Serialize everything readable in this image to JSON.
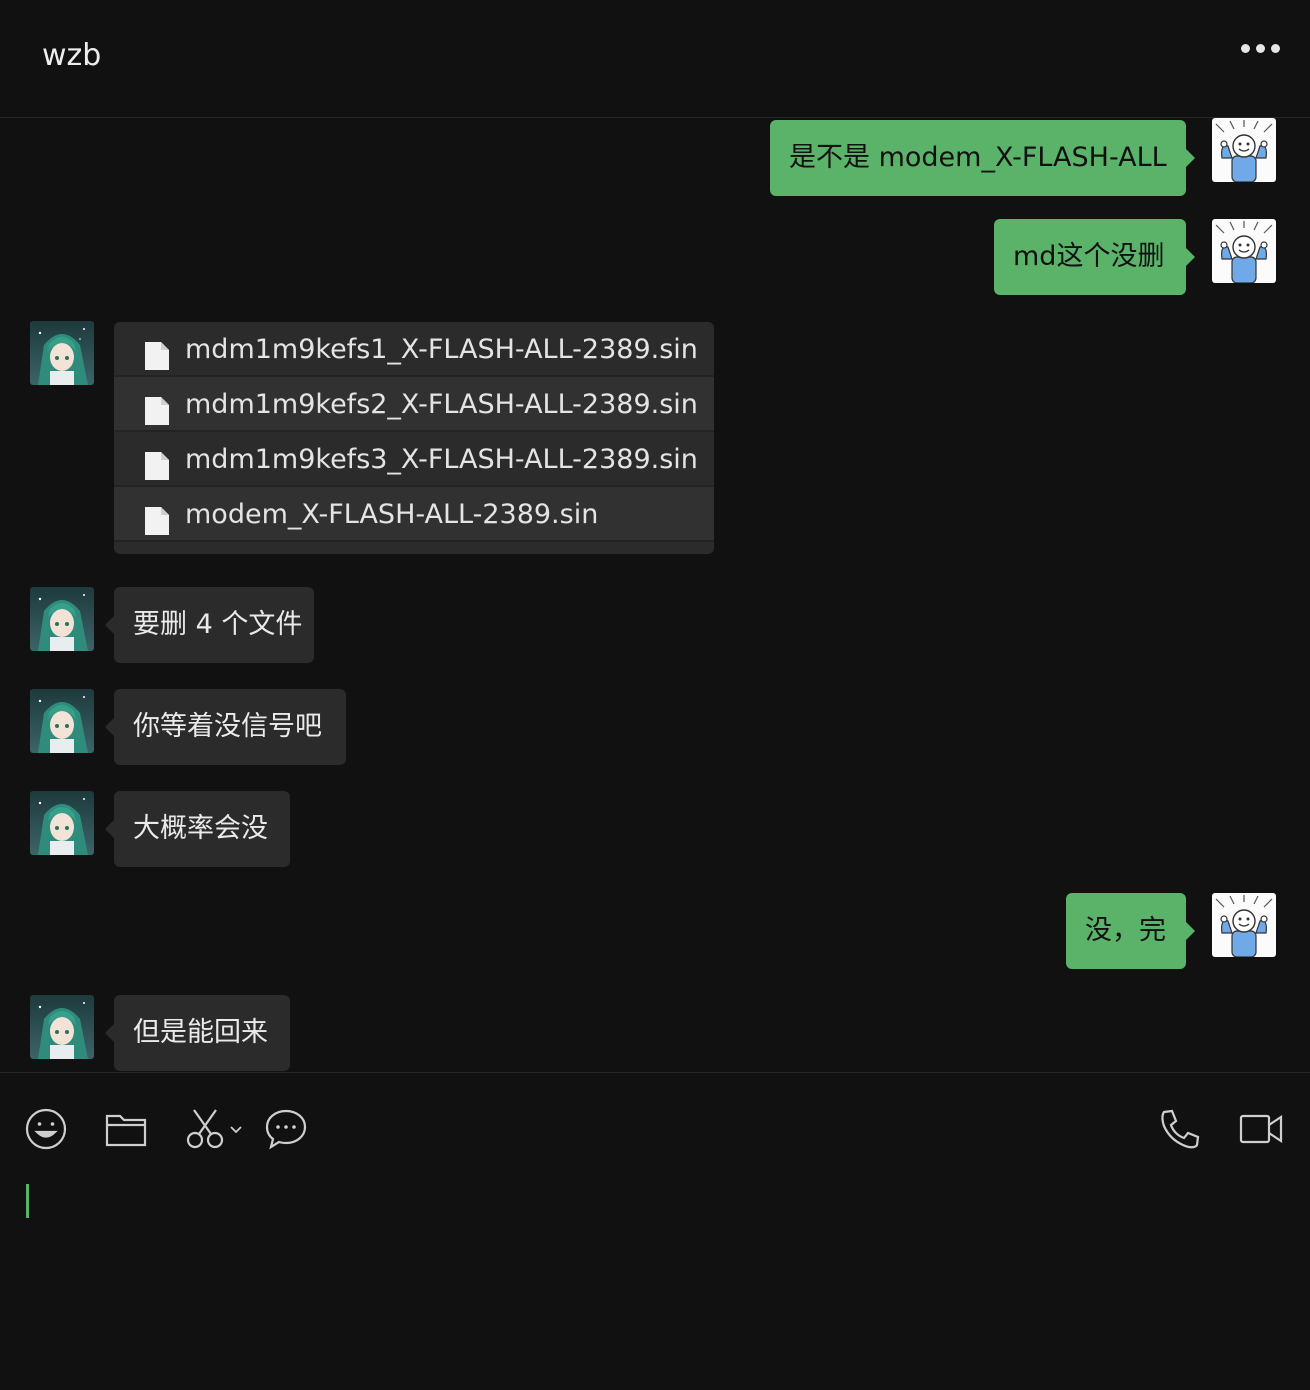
{
  "header": {
    "title": "wzb"
  },
  "messages": [
    {
      "dir": "out",
      "text": "是不是 modem_X-FLASH-ALL"
    },
    {
      "dir": "out",
      "text": "md这个没删"
    },
    {
      "dir": "in",
      "files": [
        "mdm1m9kefs1_X-FLASH-ALL-2389.sin",
        "mdm1m9kefs2_X-FLASH-ALL-2389.sin",
        "mdm1m9kefs3_X-FLASH-ALL-2389.sin",
        "modem_X-FLASH-ALL-2389.sin"
      ]
    },
    {
      "dir": "in",
      "text": "要删 4 个文件"
    },
    {
      "dir": "in",
      "text": "你等着没信号吧"
    },
    {
      "dir": "in",
      "text": "大概率会没"
    },
    {
      "dir": "out",
      "text": "没，完"
    },
    {
      "dir": "in",
      "text": "但是能回来"
    }
  ],
  "toolbar": {
    "left": [
      "emoji-icon",
      "folder-icon",
      "scissors-icon",
      "chat-bubble-icon"
    ],
    "right": [
      "phone-icon",
      "video-camera-icon"
    ]
  },
  "colors": {
    "accent": "#5bb36a",
    "background": "#111111",
    "incoming_bubble": "#2b2b2b"
  }
}
